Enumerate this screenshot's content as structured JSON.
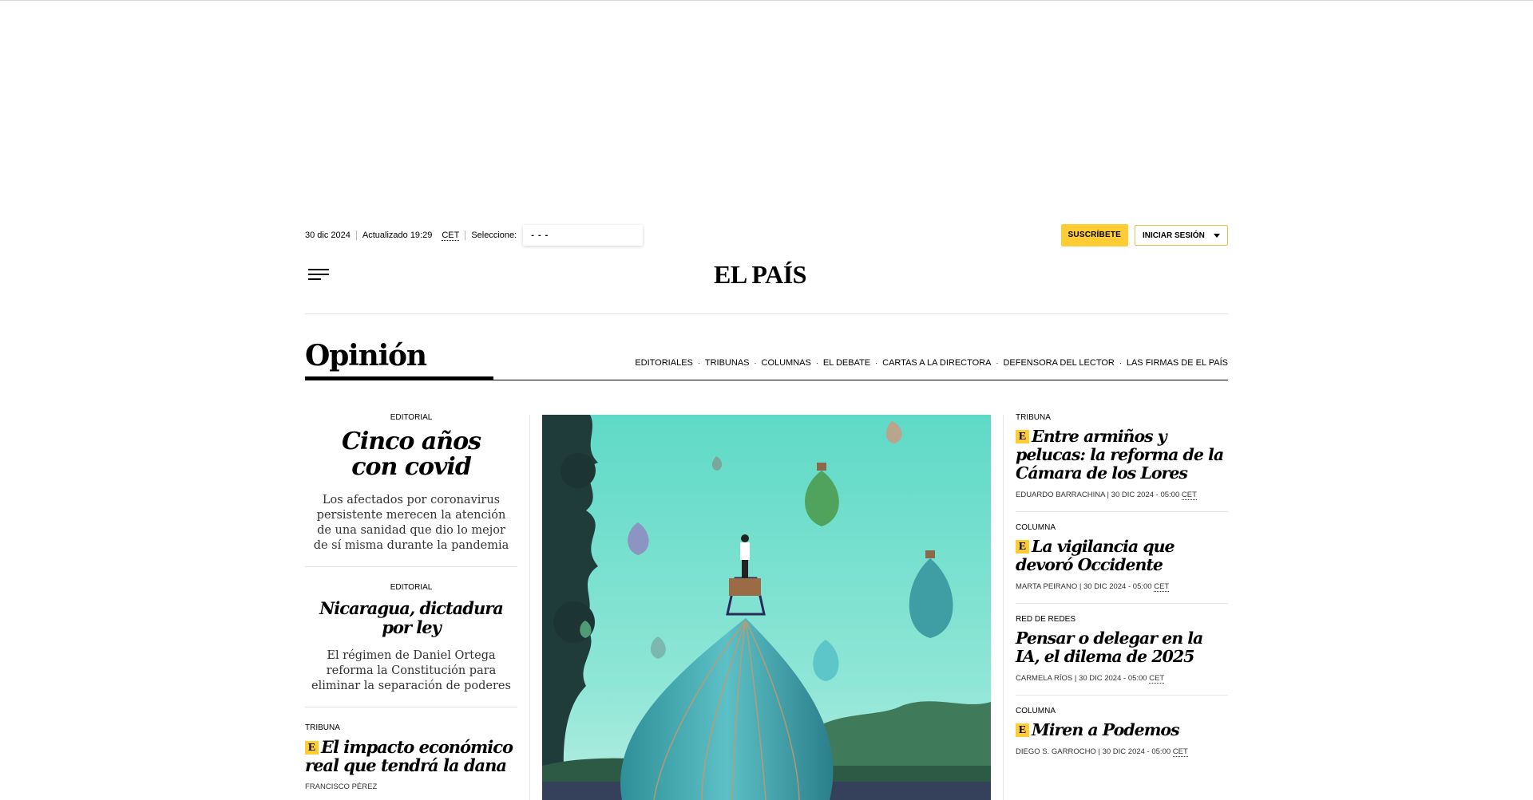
{
  "topbar": {
    "date": "30 dic 2024",
    "updated": "Actualizado 19:29",
    "timezone": "CET",
    "select_label": "Seleccione:",
    "select_value": "- - -",
    "subscribe_label": "SUSCRÍBETE",
    "login_label": "INICIAR SESIÓN"
  },
  "header": {
    "logo": "EL PAÍS"
  },
  "section": {
    "title": "Opinión",
    "nav": [
      "EDITORIALES",
      "TRIBUNAS",
      "COLUMNAS",
      "EL DEBATE",
      "CARTAS A LA DIRECTORA",
      "DEFENSORA DEL LECTOR",
      "LAS FIRMAS DE EL PAÍS"
    ]
  },
  "left_column": [
    {
      "kicker": "EDITORIAL",
      "title": "Cinco años con covid",
      "dek": "Los afectados por coronavirus persistente merecen la atención de una sanidad que dio lo mejor de sí misma durante la pandemia"
    },
    {
      "kicker": "EDITORIAL",
      "title": "Nicaragua, dictadura por ley",
      "dek": "El régimen de Daniel Ortega reforma la Constitución para eliminar la separación de poderes"
    },
    {
      "kicker": "TRIBUNA",
      "badge": "E",
      "title": "El impacto económico real que tendrá la dana",
      "byline": "FRANCISCO PÉREZ"
    }
  ],
  "right_column": [
    {
      "kicker": "TRIBUNA",
      "badge": "E",
      "title": "Entre armiños y pelucas: la reforma de la Cámara de los Lores",
      "author": "EDUARDO BARRACHINA",
      "date": "30 DIC 2024 - 05:00",
      "tz": "CET"
    },
    {
      "kicker": "COLUMNA",
      "badge": "E",
      "title": "La vigilancia que devoró Occidente",
      "author": "MARTA PEIRANO",
      "date": "30 DIC 2024 - 05:00",
      "tz": "CET"
    },
    {
      "kicker": "RED DE REDES",
      "title": "Pensar o delegar en la IA, el dilema de 2025",
      "author": "CARMELA RÍOS",
      "date": "30 DIC 2024 - 05:00",
      "tz": "CET"
    },
    {
      "kicker": "COLUMNA",
      "badge": "E",
      "title": "Miren a Podemos",
      "author": "DIEGO S. GARROCHO",
      "date": "30 DIC 2024 - 05:00",
      "tz": "CET"
    }
  ],
  "colors": {
    "accent_yellow": "#ffcc33",
    "illustration_sky": "#6fdcc8"
  },
  "icons": {
    "menu": "hamburger-icon",
    "dropdown": "caret-down-icon",
    "premium": "e-badge-icon"
  }
}
